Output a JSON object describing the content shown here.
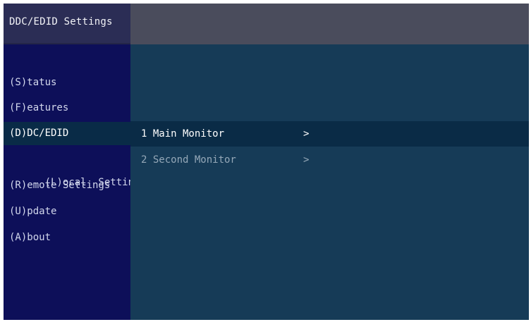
{
  "window": {
    "title": "DDC/EDID Settings"
  },
  "sidebar": {
    "items": [
      {
        "label": "(S)tatus",
        "active": false
      },
      {
        "label": "(F)eatures",
        "active": false
      },
      {
        "label": "(D)DC/EDID",
        "active": true
      },
      {
        "label": "(L)ocal  Settings",
        "active": false
      },
      {
        "label": "(R)emote Settings",
        "active": false
      },
      {
        "label": "(U)pdate",
        "active": false
      },
      {
        "label": "(A)bout",
        "active": false
      }
    ]
  },
  "content": {
    "items": [
      {
        "label": "1 Main Monitor",
        "chevron": ">",
        "selected": true
      },
      {
        "label": "2 Second Monitor",
        "chevron": ">",
        "selected": false
      }
    ]
  },
  "colors": {
    "titlebar": "#4a4c5c",
    "sidebar": "#0d0f59",
    "content": "#163b57",
    "selection": "#0a2b46"
  }
}
